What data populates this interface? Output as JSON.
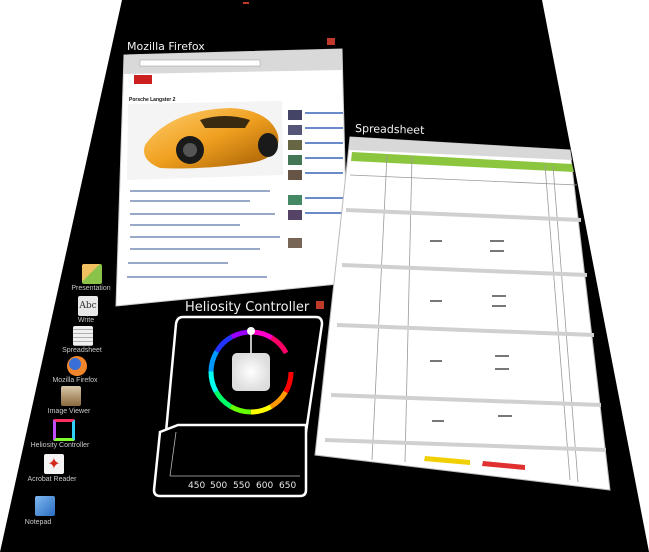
{
  "windows": {
    "firefox": {
      "title": "Mozilla Firefox",
      "page_heading": "Porsche Langster 2"
    },
    "spreadsheet": {
      "title": "Spreadsheet"
    },
    "heliosity": {
      "title": "Heliosity Controller",
      "x_ticks": [
        "450",
        "500",
        "550",
        "600",
        "650"
      ]
    }
  },
  "dock": {
    "items": [
      {
        "label": "Presentation",
        "icon": "presentation-icon",
        "color": "#e8a23a"
      },
      {
        "label": "Write",
        "icon": "write-icon",
        "color": "#e0e0e0"
      },
      {
        "label": "Spreadsheet",
        "icon": "spreadsheet-icon",
        "color": "#d9d9d9"
      },
      {
        "label": "Mozilla Firefox",
        "icon": "firefox-icon",
        "color": "#e8702a"
      },
      {
        "label": "Image Viewer",
        "icon": "image-viewer-icon",
        "color": "#b58b5a"
      },
      {
        "label": "Heliosity Controller",
        "icon": "heliosity-icon",
        "color": "#ffffff"
      },
      {
        "label": "Acrobat Reader",
        "icon": "acrobat-icon",
        "color": "#d42a1e"
      },
      {
        "label": "Notepad",
        "icon": "notepad-icon",
        "color": "#4a8fd8"
      }
    ]
  },
  "colors": {
    "desktop": "#000000",
    "window_border": "#ffffff",
    "close": "#c0392b",
    "sheet_header": "#8cc63f",
    "car": "#f0a020"
  }
}
